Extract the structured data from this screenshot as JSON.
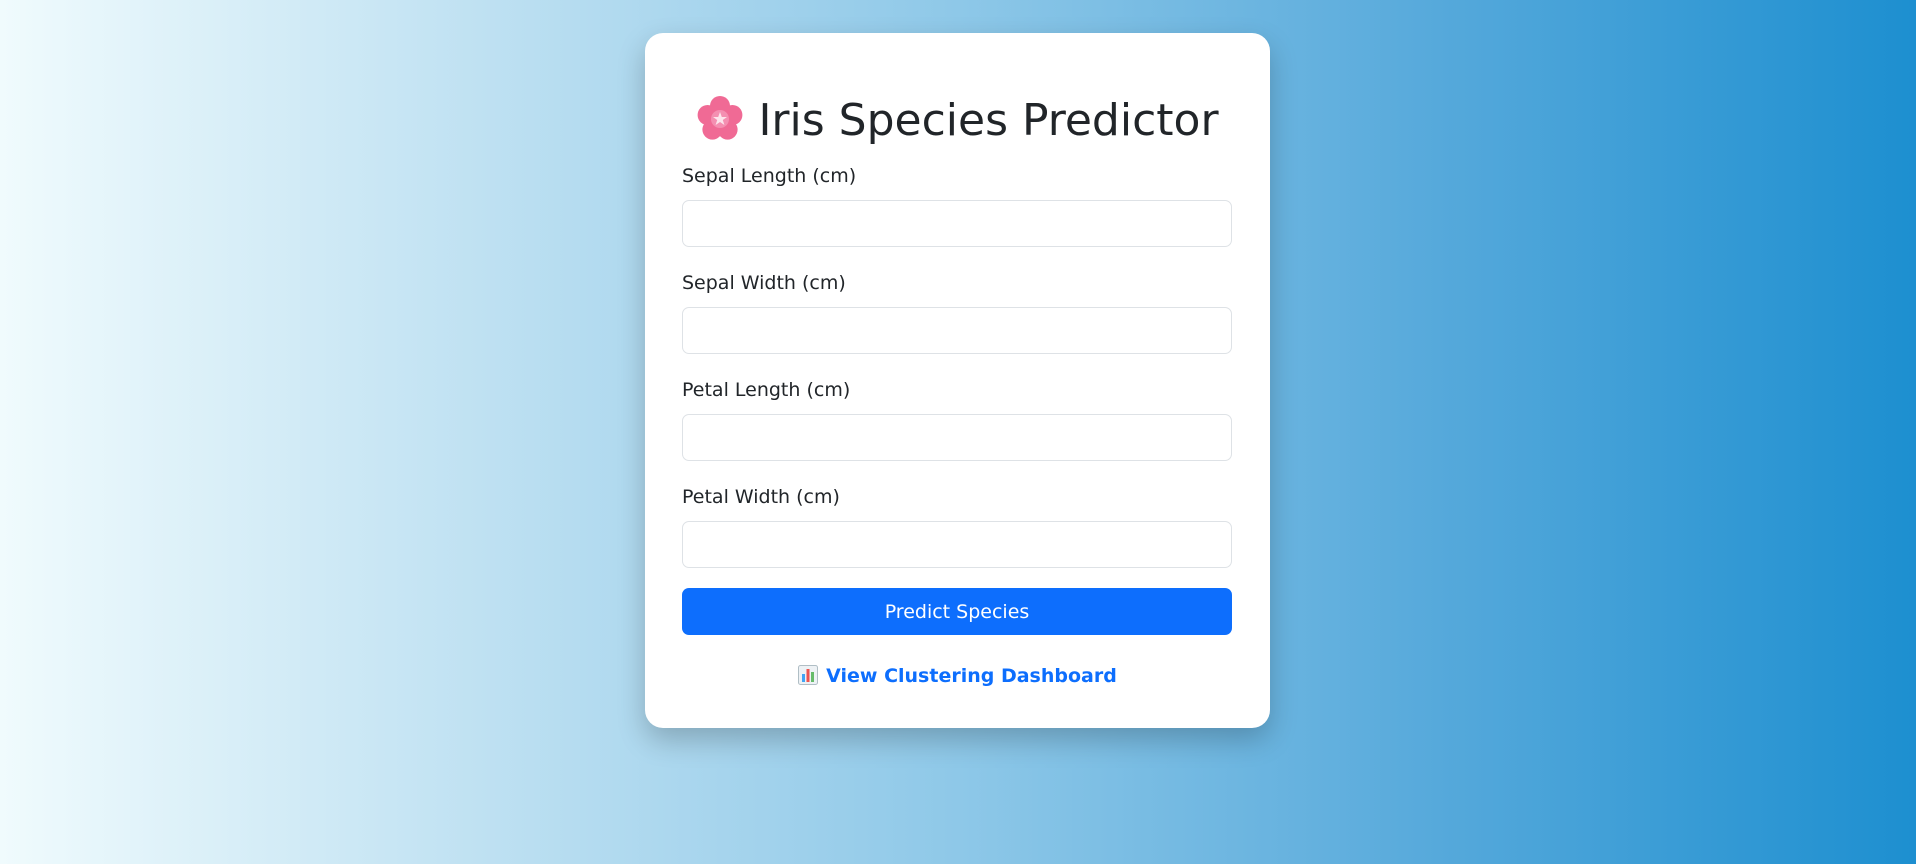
{
  "page": {
    "title": "Iris Species Predictor",
    "title_icon": "cherry-blossom-icon"
  },
  "form": {
    "fields": [
      {
        "label": "Sepal Length (cm)",
        "value": "",
        "placeholder": ""
      },
      {
        "label": "Sepal Width (cm)",
        "value": "",
        "placeholder": ""
      },
      {
        "label": "Petal Length (cm)",
        "value": "",
        "placeholder": ""
      },
      {
        "label": "Petal Width (cm)",
        "value": "",
        "placeholder": ""
      }
    ],
    "submit_label": "Predict Species"
  },
  "dashboard_link": {
    "label": "View Clustering Dashboard",
    "icon": "bar-chart-icon"
  },
  "colors": {
    "accent": "#0d6efd",
    "background_start": "#f0fbfd",
    "background_end": "#1d8fd0",
    "flower": "#f06292"
  }
}
